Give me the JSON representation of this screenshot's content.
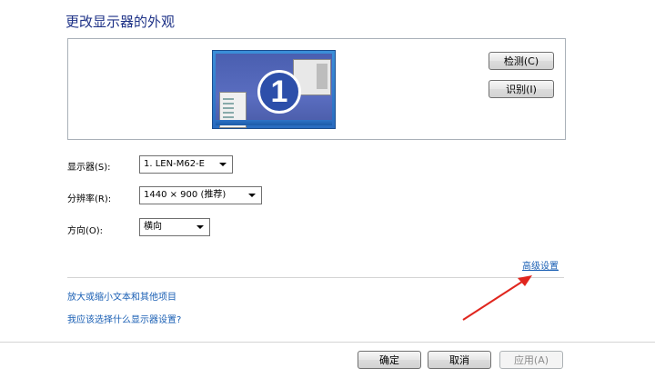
{
  "title": "更改显示器的外观",
  "preview": {
    "monitor_number": "1",
    "detect_label": "检测(C)",
    "identify_label": "识别(I)"
  },
  "settings": {
    "display_label": "显示器(S):",
    "display_value": "1. LEN-M62-E",
    "resolution_label": "分辨率(R):",
    "resolution_value": "1440 × 900 (推荐)",
    "orientation_label": "方向(O):",
    "orientation_value": "横向"
  },
  "advanced_link": "高级设置",
  "links": [
    "放大或缩小文本和其他项目",
    "我应该选择什么显示器设置?"
  ],
  "footer": {
    "ok_label": "确定",
    "cancel_label": "取消",
    "apply_label": "应用(A)"
  },
  "colors": {
    "title": "#1e3287",
    "link": "#1a5fb4",
    "arrow": "#e0261e"
  }
}
